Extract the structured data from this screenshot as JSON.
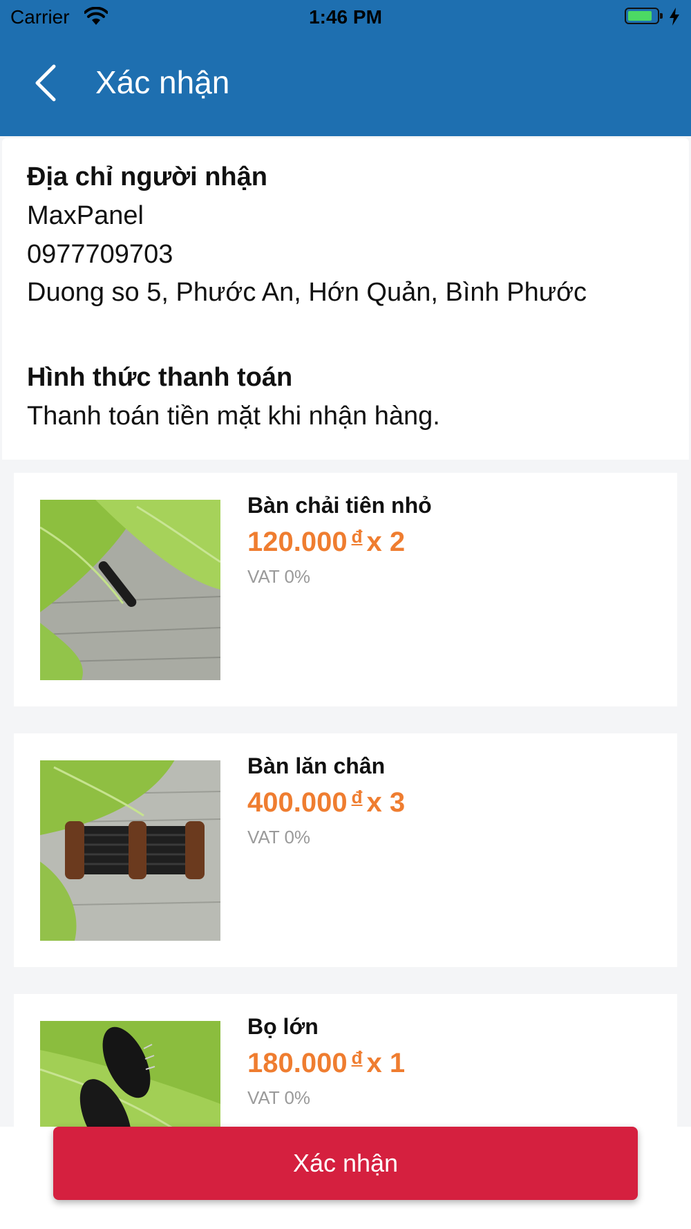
{
  "status_bar": {
    "carrier": "Carrier",
    "time": "1:46 PM",
    "battery_icon": "battery-charging-icon",
    "wifi_icon": "wifi-icon"
  },
  "nav": {
    "title": "Xác nhận",
    "back_icon": "chevron-left-icon"
  },
  "recipient": {
    "label": "Địa chỉ người nhận",
    "name": "MaxPanel",
    "phone": "0977709703",
    "address": "Duong so 5, Phước An, Hớn Quản, Bình Phước"
  },
  "payment": {
    "label": "Hình thức thanh toán",
    "method": "Thanh toán tiền mặt khi nhận hàng."
  },
  "products": [
    {
      "name": "Bàn chải tiên nhỏ",
      "price": "120.000",
      "currency": "đ",
      "quantity": "x 2",
      "vat": "VAT 0%"
    },
    {
      "name": "Bàn lăn chân",
      "price": "400.000",
      "currency": "đ",
      "quantity": "x 3",
      "vat": "VAT 0%"
    },
    {
      "name": "Bọ lớn",
      "price": "180.000",
      "currency": "đ",
      "quantity": "x 1",
      "vat": "VAT 0%"
    }
  ],
  "confirm_button": {
    "label": "Xác nhận"
  },
  "colors": {
    "header": "#1e6fb0",
    "price": "#ef7d30",
    "confirm": "#d5203f"
  }
}
